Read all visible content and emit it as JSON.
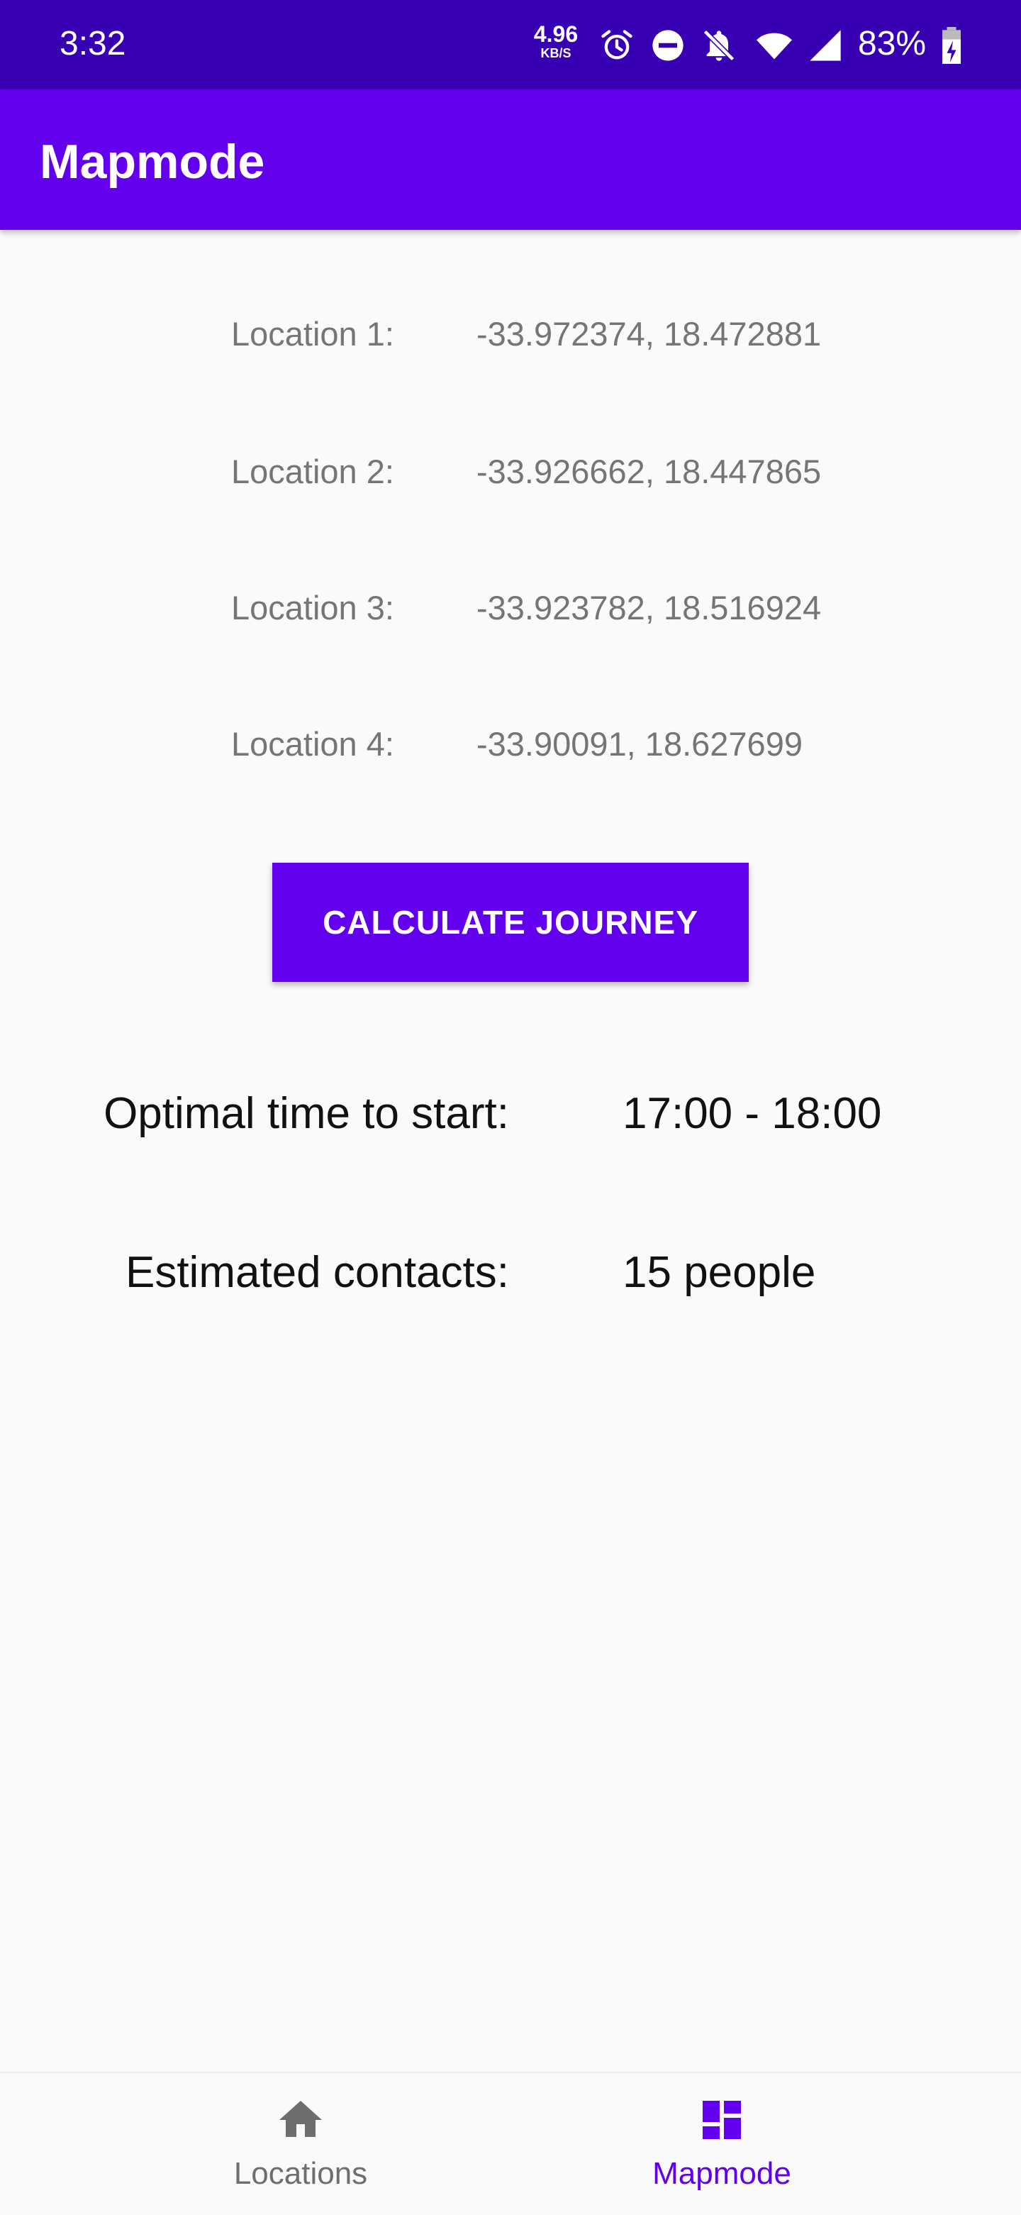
{
  "status_bar": {
    "time": "3:32",
    "speed_value": "4.96",
    "speed_unit": "KB/S",
    "battery": "83%",
    "icons": [
      "alarm-icon",
      "do-not-disturb-icon",
      "notifications-off-icon",
      "wifi-icon",
      "cellular-signal-icon",
      "battery-charging-icon"
    ]
  },
  "app_bar": {
    "title": "Mapmode"
  },
  "locations": [
    {
      "label": "Location 1:",
      "value": "-33.972374, 18.472881"
    },
    {
      "label": "Location 2:",
      "value": "-33.926662, 18.447865"
    },
    {
      "label": "Location 3:",
      "value": "-33.923782, 18.516924"
    },
    {
      "label": "Location 4:",
      "value": "-33.90091, 18.627699"
    }
  ],
  "calculate_button": {
    "label": "CALCULATE JOURNEY"
  },
  "results": {
    "optimal_time_label": "Optimal time to start:",
    "optimal_time_value": "17:00 - 18:00",
    "contacts_label": "Estimated contacts:",
    "contacts_value": "15 people"
  },
  "bottom_nav": {
    "items": [
      {
        "label": "Locations",
        "icon": "home-icon",
        "active": false
      },
      {
        "label": "Mapmode",
        "icon": "dashboard-icon",
        "active": true
      }
    ]
  },
  "colors": {
    "primary": "#6200ee",
    "primary_dark": "#3700b3",
    "active_nav": "#6200ee",
    "inactive_nav": "#6e6e6e",
    "background": "#fafafa"
  }
}
